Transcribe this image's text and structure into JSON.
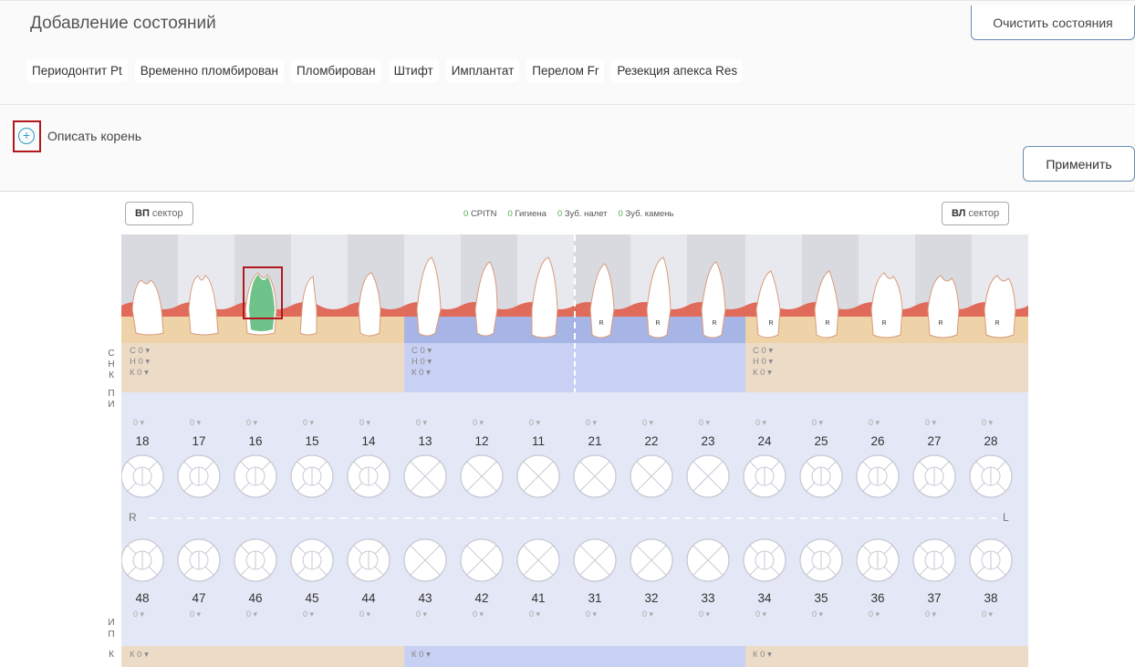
{
  "header": {
    "title": "Добавление состояний",
    "clear_label": "Очистить состояния"
  },
  "chips": [
    "Периодонтит Pt",
    "Временно пломбирован",
    "Пломбирован",
    "Штифт",
    "Имплантат",
    "Перелом Fr",
    "Резекция апекса Res"
  ],
  "root": {
    "label": "Описать корень",
    "apply_label": "Применить"
  },
  "sectors": {
    "left_bold": "ВП",
    "left_rest": "сектор",
    "right_bold": "ВЛ",
    "right_rest": "сектор"
  },
  "stats": [
    {
      "value": "0",
      "label": "CPITN"
    },
    {
      "value": "0",
      "label": "Гигиена"
    },
    {
      "value": "0",
      "label": "Зуб. налет"
    },
    {
      "value": "0",
      "label": "Зуб. камень"
    }
  ],
  "side_letters_top": [
    "С",
    "Н",
    "К",
    "П",
    "И"
  ],
  "side_letters_bottom": [
    "И",
    "П",
    "К"
  ],
  "selectors_top": [
    "С 0",
    "Н 0",
    "К 0"
  ],
  "selector_bottom": "К 0",
  "mini_value": "0",
  "upper_teeth": [
    "18",
    "17",
    "16",
    "15",
    "14",
    "13",
    "12",
    "11",
    "21",
    "22",
    "23",
    "24",
    "25",
    "26",
    "27",
    "28"
  ],
  "lower_teeth": [
    "48",
    "47",
    "46",
    "45",
    "44",
    "43",
    "42",
    "41",
    "31",
    "32",
    "33",
    "34",
    "35",
    "36",
    "37",
    "38"
  ],
  "marker_R": "R",
  "marker_L": "L",
  "tooth_mark": "R",
  "colors": {
    "gum": "#e06b5b",
    "crown_bg": "#efd3a8",
    "sector_blue": "#a7b5e6",
    "accent": "#2aa0c8",
    "highlight": "#b3171e",
    "green": "#4caf50"
  }
}
